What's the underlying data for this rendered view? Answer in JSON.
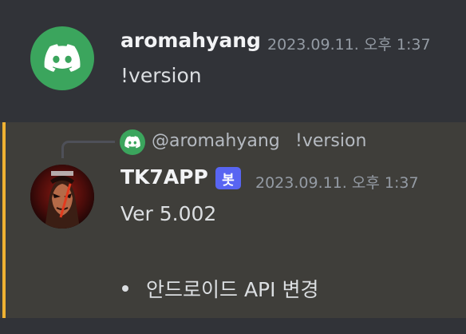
{
  "messages": [
    {
      "author": "aromahyang",
      "timestamp": "2023.09.11. 오후 1:37",
      "content": "!version",
      "avatar_icon": "discord-logo-icon",
      "avatar_color": "#3ba55d"
    },
    {
      "reply": {
        "author": "@aromahyang",
        "text": "!version",
        "avatar_icon": "discord-logo-icon"
      },
      "author": "TK7APP",
      "bot_badge": "봇",
      "timestamp": "2023.09.11. 오후 1:37",
      "content_lines": [
        "Ver 5.002"
      ],
      "bullets": [
        "안드로이드 API 변경"
      ],
      "avatar_icon": "tekken-character-avatar-icon",
      "highlight_color": "#f0b232",
      "badge_color": "#5865f2"
    }
  ]
}
